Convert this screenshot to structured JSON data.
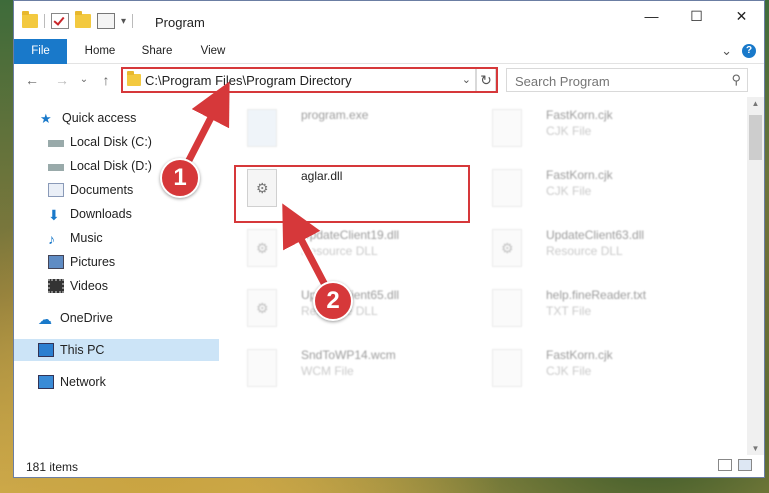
{
  "window": {
    "title": "Program",
    "minimize": "—",
    "maximize": "☐",
    "close": "✕"
  },
  "ribbon": {
    "tabs": [
      "File",
      "Home",
      "Share",
      "View"
    ],
    "expand": "⌄",
    "help": "?"
  },
  "nav": {
    "back": "←",
    "forward": "→",
    "recent": "⌄",
    "up": "↑",
    "address": "C:\\Program Files\\Program Directory",
    "dropdown": "⌄",
    "refresh": "↻",
    "search_placeholder": "Search Program",
    "search_icon": "⚲"
  },
  "sidebar": {
    "items": [
      {
        "label": "Quick access",
        "icon": "star-icon"
      },
      {
        "label": "Local Disk (C:)",
        "icon": "drive-icon"
      },
      {
        "label": "Local Disk (D:)",
        "icon": "drive-icon"
      },
      {
        "label": "Documents",
        "icon": "documents-icon"
      },
      {
        "label": "Downloads",
        "icon": "download-icon"
      },
      {
        "label": "Music",
        "icon": "music-icon"
      },
      {
        "label": "Pictures",
        "icon": "pictures-icon"
      },
      {
        "label": "Videos",
        "icon": "videos-icon"
      },
      {
        "label": "OneDrive",
        "icon": "cloud-icon"
      },
      {
        "label": "This PC",
        "icon": "computer-icon"
      },
      {
        "label": "Network",
        "icon": "network-icon"
      }
    ],
    "pin": "📌"
  },
  "files": [
    {
      "name": "program.exe",
      "type": ""
    },
    {
      "name": "FastKorn.cjk",
      "type": "CJK File"
    },
    {
      "name": "aglar.dll",
      "type": ""
    },
    {
      "name": "FastKorn.cjk",
      "type": "CJK File"
    },
    {
      "name": "UpdateClient19.dll",
      "type": "Resource DLL"
    },
    {
      "name": "UpdateClient63.dll",
      "type": "Resource DLL"
    },
    {
      "name": "UpdateClient65.dll",
      "type": "Resource DLL"
    },
    {
      "name": "help.fineReader.txt",
      "type": "TXT File"
    },
    {
      "name": "SndToWP14.wcm",
      "type": "WCM File"
    },
    {
      "name": "FastKorn.cjk",
      "type": "CJK File"
    }
  ],
  "status": {
    "count": "181 items"
  },
  "annotations": {
    "step1": "1",
    "step2": "2"
  },
  "colors": {
    "accent": "#1979ca",
    "highlight": "#d6383a",
    "selected": "#cce4f7"
  }
}
